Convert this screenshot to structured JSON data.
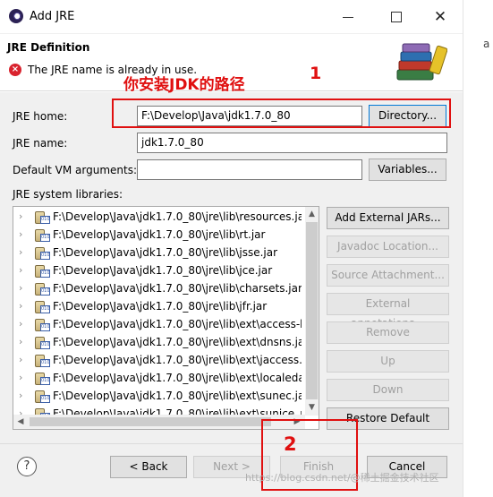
{
  "window": {
    "title": "Add JRE",
    "close_glyph": "✕"
  },
  "header": {
    "section_title": "JRE Definition",
    "error_message": "The JRE name is already in use.",
    "error_glyph": "×",
    "banner_icon": "books-icon"
  },
  "annotations": {
    "label": "你安装JDK的路径",
    "marker1": "1",
    "marker2": "2",
    "color": "#e01010"
  },
  "form": {
    "jre_home_label": "JRE home:",
    "jre_home_value": "F:\\Develop\\Java\\jdk1.7.0_80",
    "directory_button": "Directory...",
    "jre_name_label": "JRE name:",
    "jre_name_value": "jdk1.7.0_80",
    "vm_args_label": "Default VM arguments:",
    "vm_args_value": "",
    "variables_button": "Variables...",
    "libraries_label": "JRE system libraries:"
  },
  "libraries": [
    "F:\\Develop\\Java\\jdk1.7.0_80\\jre\\lib\\resources.jar",
    "F:\\Develop\\Java\\jdk1.7.0_80\\jre\\lib\\rt.jar",
    "F:\\Develop\\Java\\jdk1.7.0_80\\jre\\lib\\jsse.jar",
    "F:\\Develop\\Java\\jdk1.7.0_80\\jre\\lib\\jce.jar",
    "F:\\Develop\\Java\\jdk1.7.0_80\\jre\\lib\\charsets.jar",
    "F:\\Develop\\Java\\jdk1.7.0_80\\jre\\lib\\jfr.jar",
    "F:\\Develop\\Java\\jdk1.7.0_80\\jre\\lib\\ext\\access-br",
    "F:\\Develop\\Java\\jdk1.7.0_80\\jre\\lib\\ext\\dnsns.jar",
    "F:\\Develop\\Java\\jdk1.7.0_80\\jre\\lib\\ext\\jaccess.jar",
    "F:\\Develop\\Java\\jdk1.7.0_80\\jre\\lib\\ext\\localedat",
    "F:\\Develop\\Java\\jdk1.7.0_80\\jre\\lib\\ext\\sunec.jar",
    "F:\\Develop\\Java\\jdk1.7.0_80\\jre\\lib\\ext\\sunjce_pro"
  ],
  "side_buttons": {
    "add_external": "Add External JARs...",
    "javadoc": "Javadoc Location...",
    "source": "Source Attachment...",
    "external_annotations": "External annotations...",
    "remove": "Remove",
    "up": "Up",
    "down": "Down",
    "restore": "Restore Default"
  },
  "footer": {
    "help_glyph": "?",
    "back": "< Back",
    "next": "Next >",
    "finish": "Finish",
    "cancel": "Cancel",
    "watermark": "https://blog.csdn.net/@稀土掘金技术社区"
  },
  "right_fragment": "a"
}
